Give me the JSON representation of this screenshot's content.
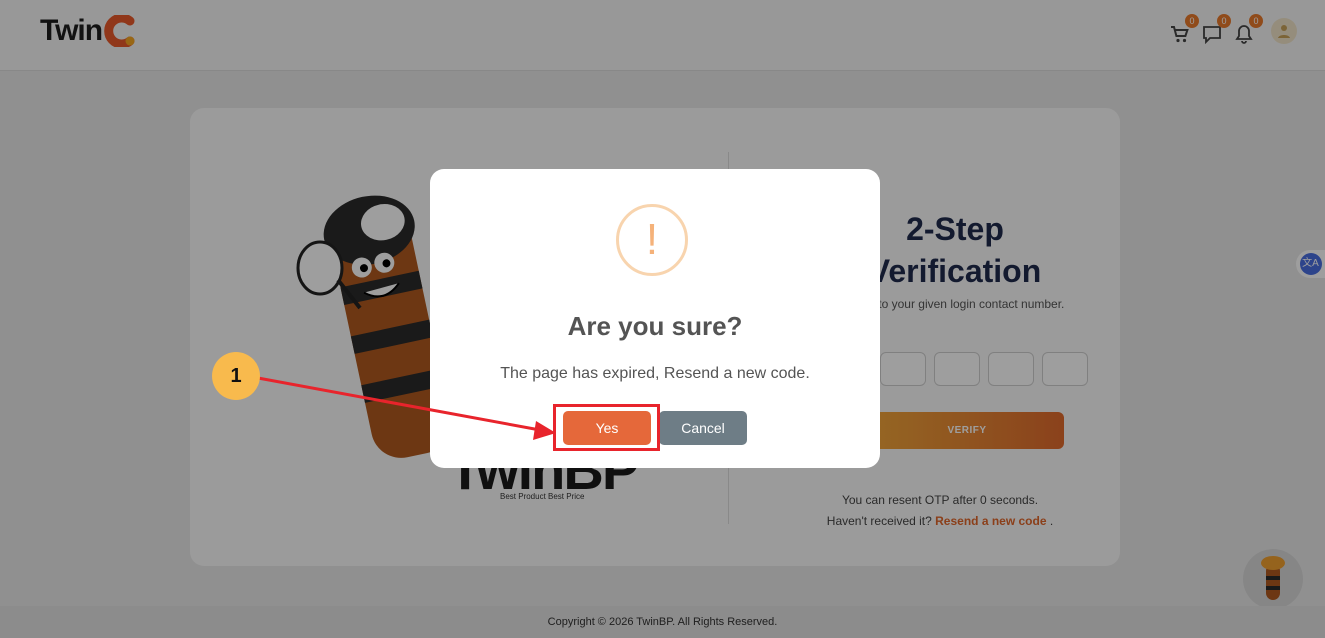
{
  "header": {
    "logo_text": "Twin",
    "cart_count": "0",
    "messages_count": "0",
    "notifications_count": "0"
  },
  "brand": {
    "name": "TwinBP",
    "tagline": "Best Product Best Price"
  },
  "verification": {
    "title_line1": "2-Step",
    "title_line2": "Verification",
    "description": "...ved to your given login contact number.",
    "verify_label": "VERIFY",
    "resend_timer": "You can resent OTP after 0 seconds.",
    "resend_prompt": "Haven't received it?",
    "resend_link": "Resend a new code",
    "resend_suffix": "."
  },
  "modal": {
    "icon_glyph": "!",
    "title": "Are you sure?",
    "text": "The page has expired, Resend a new code.",
    "yes_label": "Yes",
    "cancel_label": "Cancel"
  },
  "annotation": {
    "step_number": "1"
  },
  "translate": {
    "label": "文A"
  },
  "footer": {
    "copyright": "Copyright © 2026 TwinBP. All Rights Reserved."
  }
}
